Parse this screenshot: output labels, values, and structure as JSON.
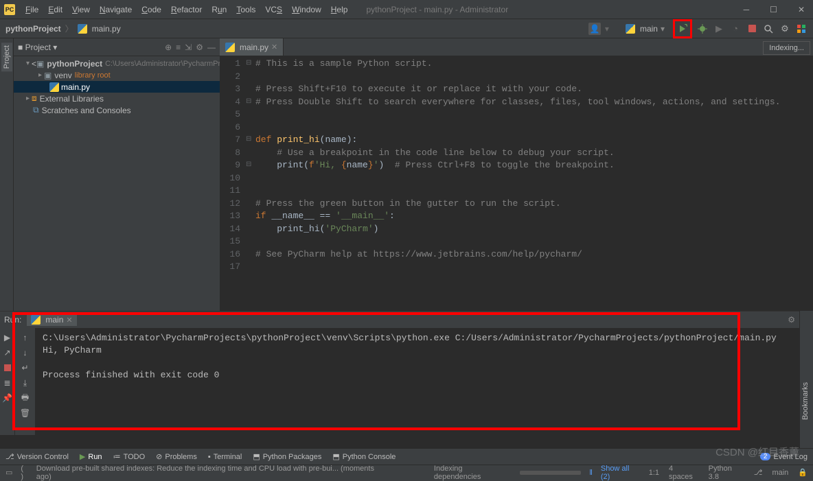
{
  "app": {
    "icon_text": "PC",
    "title": "pythonProject - main.py - Administrator"
  },
  "menu": [
    "File",
    "Edit",
    "View",
    "Navigate",
    "Code",
    "Refactor",
    "Run",
    "Tools",
    "VCS",
    "Window",
    "Help"
  ],
  "breadcrumb": {
    "project": "pythonProject",
    "file": "main.py"
  },
  "runconfig": {
    "label": "main"
  },
  "indexing": "Indexing...",
  "project_panel": {
    "title": "Project",
    "tree": {
      "root": "pythonProject",
      "root_path": "C:\\Users\\Administrator\\PycharmProjects",
      "venv": "venv",
      "venv_tag": "library root",
      "file": "main.py",
      "ext": "External Libraries",
      "scratch": "Scratches and Consoles"
    }
  },
  "editor": {
    "tab": "main.py",
    "lines": [
      "# This is a sample Python script.",
      "",
      "# Press Shift+F10 to execute it or replace it with your code.",
      "# Press Double Shift to search everywhere for classes, files, tool windows, actions, and settings.",
      "",
      "",
      "def print_hi(name):",
      "    # Use a breakpoint in the code line below to debug your script.",
      "    print(f'Hi, {name}')  # Press Ctrl+F8 to toggle the breakpoint.",
      "",
      "",
      "# Press the green button in the gutter to run the script.",
      "if __name__ == '__main__':",
      "    print_hi('PyCharm')",
      "",
      "# See PyCharm help at https://www.jetbrains.com/help/pycharm/",
      ""
    ]
  },
  "run": {
    "label": "Run:",
    "tab": "main",
    "output": "C:\\Users\\Administrator\\PycharmProjects\\pythonProject\\venv\\Scripts\\python.exe C:/Users/Administrator/PycharmProjects/pythonProject/main.py\nHi, PyCharm\n\nProcess finished with exit code 0"
  },
  "bottom_tools": {
    "vcs": "Version Control",
    "run": "Run",
    "todo": "TODO",
    "problems": "Problems",
    "terminal": "Terminal",
    "pypkg": "Python Packages",
    "pycon": "Python Console",
    "event": "Event Log",
    "event_count": "2"
  },
  "status": {
    "msg": "Download pre-built shared indexes: Reduce the indexing time and CPU load with pre-bui... (moments ago)",
    "indexing": "Indexing dependencies",
    "showall": "Show all (2)",
    "pos": "1:1",
    "indent": "4 spaces",
    "python": "Python 3.8",
    "branch": "main"
  },
  "left_tabs": {
    "project": "Project",
    "bookmarks": "Bookmarks"
  },
  "watermark": "CSDN @红目香薰"
}
